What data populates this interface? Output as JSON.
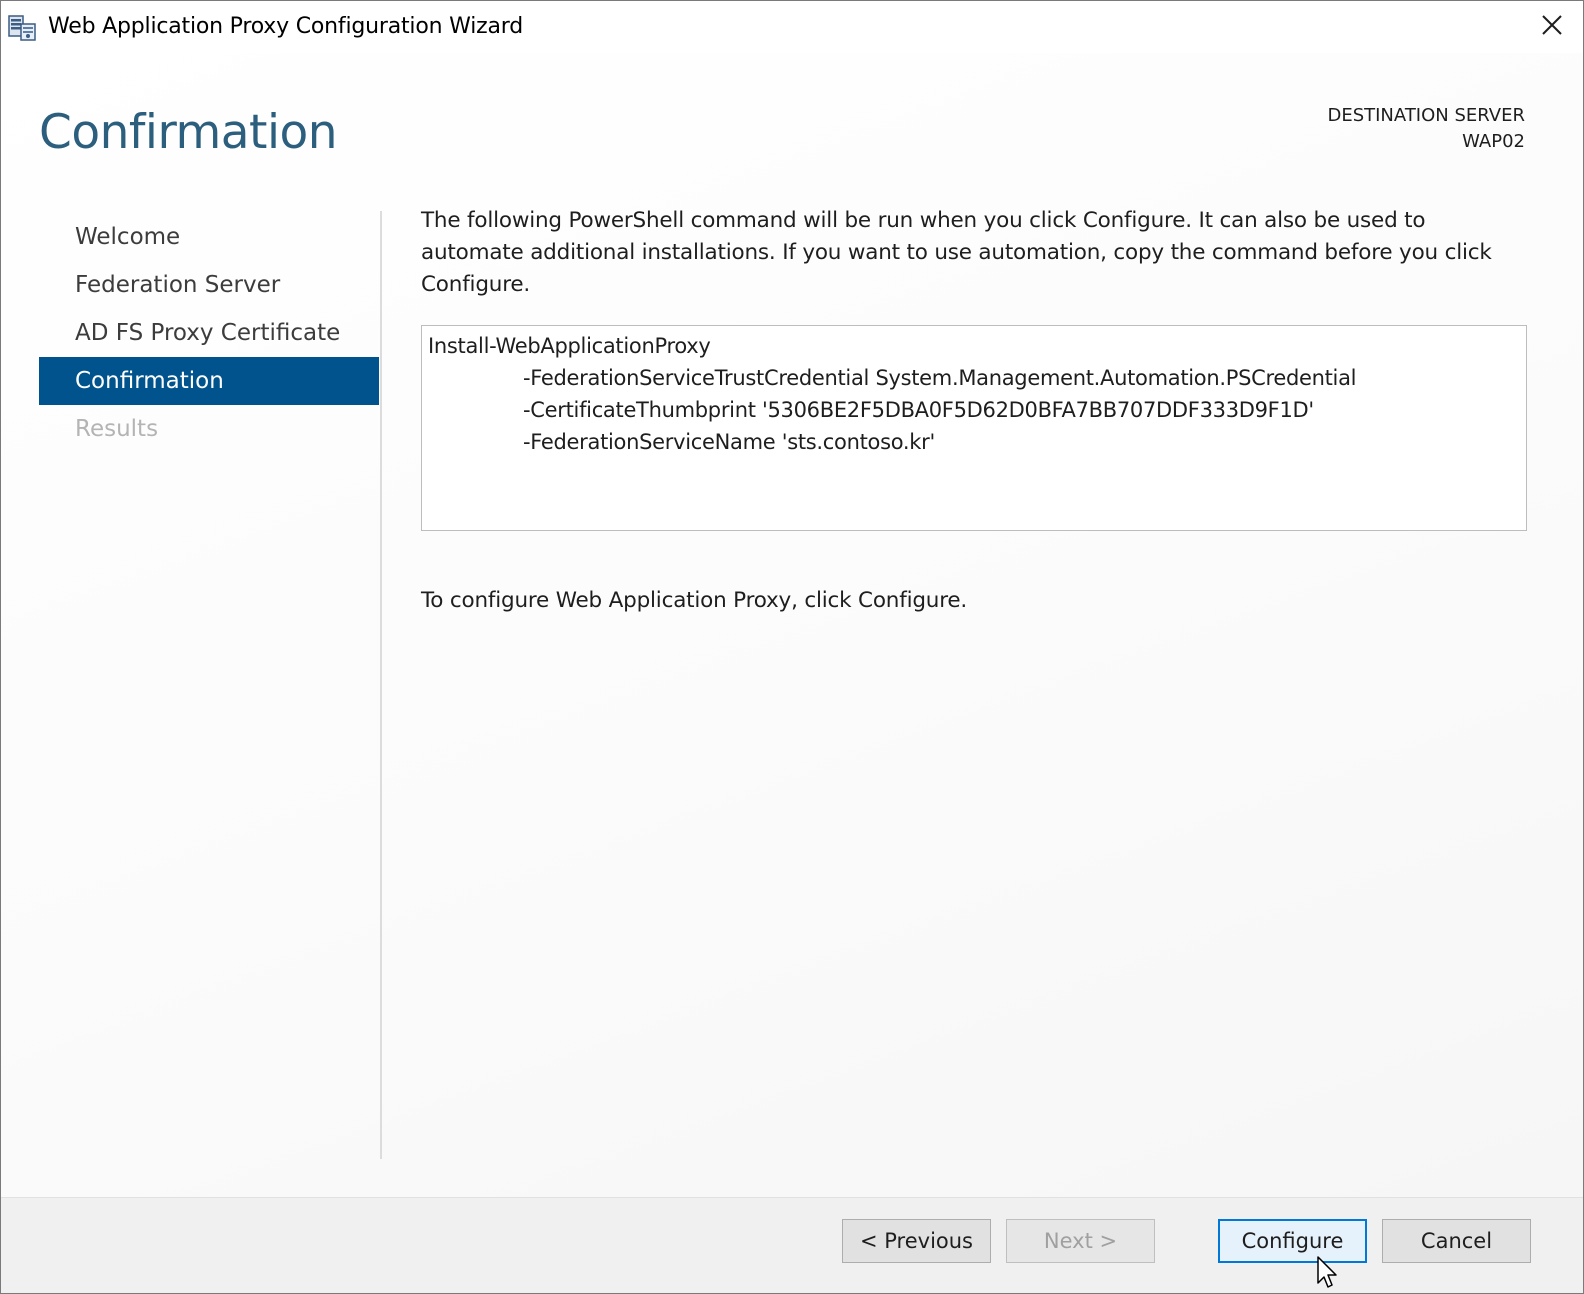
{
  "window": {
    "title": "Web Application Proxy Configuration Wizard"
  },
  "header": {
    "page_title": "Confirmation",
    "destination_label": "DESTINATION SERVER",
    "destination_value": "WAP02"
  },
  "sidebar": {
    "items": [
      {
        "label": "Welcome",
        "state": "normal"
      },
      {
        "label": "Federation Server",
        "state": "normal"
      },
      {
        "label": "AD FS Proxy Certificate",
        "state": "normal"
      },
      {
        "label": "Confirmation",
        "state": "active"
      },
      {
        "label": "Results",
        "state": "disabled"
      }
    ]
  },
  "main": {
    "intro": "The following PowerShell command will be run when you click Configure. It can also be used to automate additional installations. If you want to use automation, copy the command before you click Configure.",
    "command_lines": [
      "Install-WebApplicationProxy",
      "-FederationServiceTrustCredential System.Management.Automation.PSCredential",
      "-CertificateThumbprint '5306BE2F5DBA0F5D62D0BFA7BB707DDF333D9F1D'",
      "-FederationServiceName 'sts.contoso.kr'"
    ],
    "footer": "To configure Web Application Proxy, click Configure."
  },
  "buttons": {
    "previous": "< Previous",
    "next": "Next >",
    "configure": "Configure",
    "cancel": "Cancel"
  },
  "colors": {
    "heading": "#2c5f7e",
    "active_nav": "#00538c",
    "primary_border": "#0078d7"
  }
}
